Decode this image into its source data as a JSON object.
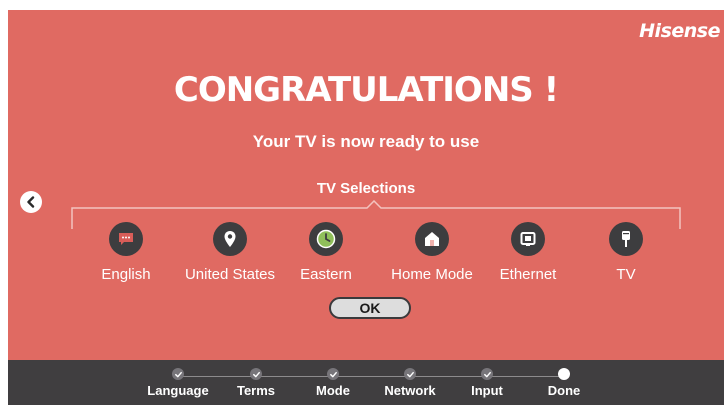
{
  "brand": {
    "logo_text": "Hisense"
  },
  "header": {
    "title": "CONGRATULATIONS !",
    "subtitle": "Your TV is now ready to use"
  },
  "selections": {
    "label": "TV Selections",
    "items": [
      {
        "label": "English",
        "icon": "chat-bubble-icon"
      },
      {
        "label": "United States",
        "icon": "location-pin-icon"
      },
      {
        "label": "Eastern",
        "icon": "clock-icon"
      },
      {
        "label": "Home Mode",
        "icon": "home-icon"
      },
      {
        "label": "Ethernet",
        "icon": "ethernet-icon"
      },
      {
        "label": "TV",
        "icon": "antenna-icon"
      }
    ]
  },
  "actions": {
    "ok_label": "OK",
    "back_icon": "chevron-left-icon"
  },
  "progress": {
    "steps": [
      {
        "label": "Language",
        "status": "done"
      },
      {
        "label": "Terms",
        "status": "done"
      },
      {
        "label": "Mode",
        "status": "done"
      },
      {
        "label": "Network",
        "status": "done"
      },
      {
        "label": "Input",
        "status": "done"
      },
      {
        "label": "Done",
        "status": "current"
      }
    ]
  },
  "colors": {
    "background": "#e06a62",
    "icon_circle": "#3d3d3f",
    "footer": "#403e40",
    "clock_accent": "#8fbf5a"
  }
}
